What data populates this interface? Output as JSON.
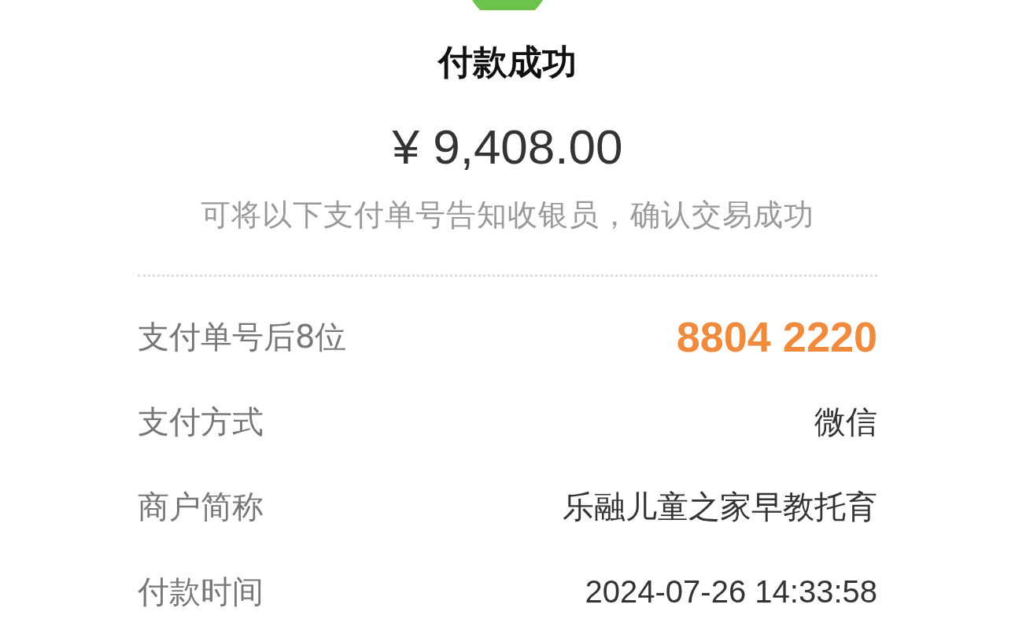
{
  "title": "付款成功",
  "amount": "¥ 9,408.00",
  "hint": "可将以下支付单号告知收银员，确认交易成功",
  "rows": [
    {
      "label": "支付单号后8位",
      "value": "8804 2220",
      "kind": "highlight"
    },
    {
      "label": "支付方式",
      "value": "微信",
      "kind": "plain"
    },
    {
      "label": "商户简称",
      "value": "乐融儿童之家早教托育",
      "kind": "plain"
    },
    {
      "label": "付款时间",
      "value": "2024-07-26 14:33:58",
      "kind": "plain"
    }
  ]
}
